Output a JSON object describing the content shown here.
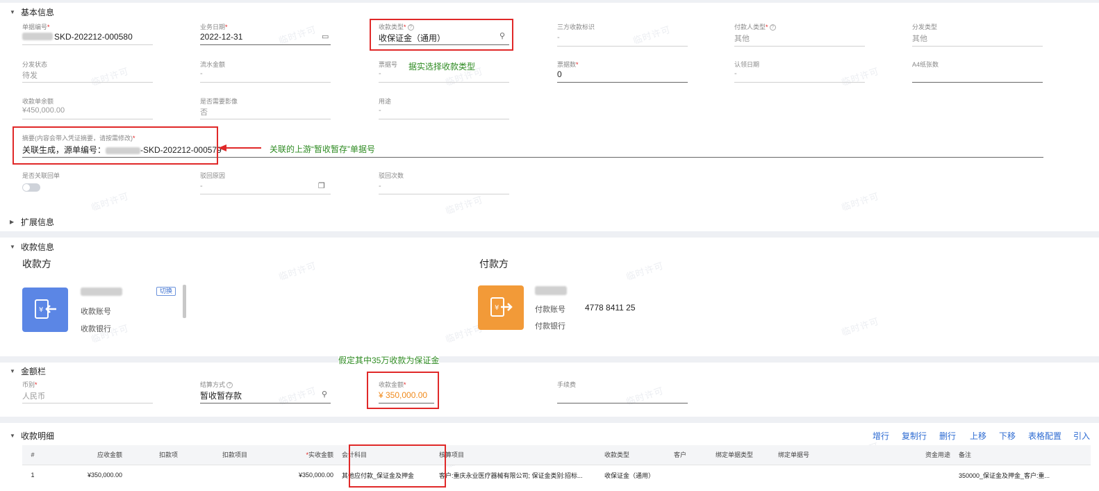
{
  "sections": {
    "basic": "基本信息",
    "extended": "扩展信息",
    "payment_info": "收款信息",
    "amount": "金额栏",
    "details": "收款明细"
  },
  "basic_fields": {
    "doc_no": {
      "label": "单据编号",
      "value": "SKD-202212-000580"
    },
    "biz_date": {
      "label": "业务日期",
      "value": "2022-12-31"
    },
    "receipt_type": {
      "label": "收款类型",
      "value": "收保证金（通用）"
    },
    "third_party_flag": {
      "label": "三方收款标识",
      "value": "-"
    },
    "payer_type": {
      "label": "付款人类型",
      "value": "其他"
    },
    "dist_type": {
      "label": "分发类型",
      "value": "其他"
    },
    "dist_status": {
      "label": "分发状态",
      "value": "待发"
    },
    "flow_amount": {
      "label": "流水金额",
      "value": "-"
    },
    "bill_no": {
      "label": "票据号",
      "value": "-"
    },
    "bill_count": {
      "label": "票据数",
      "value": "0"
    },
    "claim_date": {
      "label": "认领日期",
      "value": "-"
    },
    "a4_pages": {
      "label": "A4纸张数",
      "value": ""
    },
    "receipt_balance": {
      "label": "收款单余额",
      "value": "¥450,000.00"
    },
    "need_image": {
      "label": "是否需要影像",
      "value": "否"
    },
    "usage": {
      "label": "用途",
      "value": "-"
    },
    "summary": {
      "label": "摘要(内容会带入凭证摘要，请按需修改)",
      "value_prefix": "关联生成，源单编号：",
      "value_suffix": "-SKD-202212-000579"
    },
    "is_related_return": {
      "label": "是否关联回单"
    },
    "return_reason": {
      "label": "驳回原因",
      "value": "-"
    },
    "return_times": {
      "label": "驳回次数",
      "value": "-"
    }
  },
  "annotations": {
    "receipt_type_note": "据实选择收款类型",
    "summary_note": "关联的上游“暂收暂存”单据号",
    "amount_note": "假定其中35万收款为保证金"
  },
  "payee": {
    "title": "收款方",
    "switch_label": "切换",
    "account_label": "收款账号",
    "bank_label": "收款银行"
  },
  "payer": {
    "title": "付款方",
    "account_label": "付款账号",
    "account_value": "4778 8411 25",
    "bank_label": "付款银行"
  },
  "amount_fields": {
    "currency": {
      "label": "币别",
      "value": "人民币"
    },
    "settle_method": {
      "label": "结算方式",
      "value": "暂收暂存款"
    },
    "receipt_amount": {
      "label": "收款金额",
      "value": "¥ 350,000.00"
    },
    "fee": {
      "label": "手续费",
      "value": ""
    }
  },
  "toolbar": [
    "增行",
    "复制行",
    "删行",
    "上移",
    "下移",
    "表格配置",
    "引入"
  ],
  "table": {
    "headers": [
      "#",
      "应收金额",
      "扣款项",
      "扣款项目",
      "实收金额",
      "会计科目",
      "核算项目",
      "收款类型",
      "客户",
      "绑定单据类型",
      "绑定单据号",
      "资金用途",
      "备注"
    ],
    "rows": [
      [
        "1",
        "¥350,000.00",
        "",
        "",
        "¥350,000.00",
        "其他应付款_保证金及押金",
        "客户:重庆永业医疗器械有限公司; 保证金类别:招标...",
        "收保证金（通用）",
        "",
        "",
        "",
        "",
        "350000_保证金及押金_客户:重..."
      ]
    ]
  },
  "watermark": "临时许可",
  "colors": {
    "annotation_box": "#e02828",
    "annotation_text": "#2e8b22",
    "amount_orange": "#f08a1c",
    "link_blue": "#2d6bd2"
  }
}
